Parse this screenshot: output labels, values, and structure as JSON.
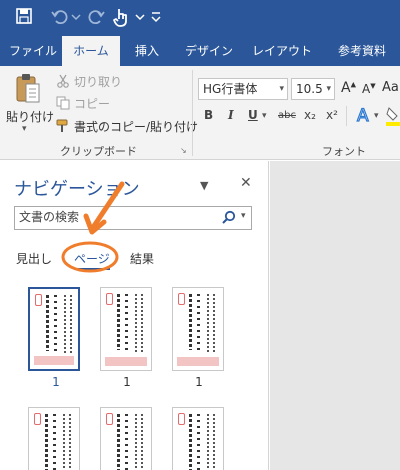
{
  "ribbon_tabs": [
    "ファイル",
    "ホーム",
    "挿入",
    "デザイン",
    "レイアウト",
    "参考資料"
  ],
  "active_tab": "ホーム",
  "clipboard": {
    "paste_label": "貼り付け",
    "cut_label": "切り取り",
    "copy_label": "コピー",
    "format_painter_label": "書式のコピー/貼り付け",
    "group_label": "クリップボード"
  },
  "font": {
    "family": "HG行書体",
    "size": "10.5",
    "grow_label": "A",
    "shrink_label": "A",
    "case_label": "Aa",
    "bold": "B",
    "italic": "I",
    "underline": "U",
    "strikethrough": "abc",
    "subscript": "x₂",
    "superscript": "x²",
    "group_label": "フォント"
  },
  "navigation": {
    "title": "ナビゲーション",
    "search_placeholder": "文書の検索",
    "tabs": [
      "見出し",
      "ページ",
      "結果"
    ],
    "active_tab": "ページ",
    "thumbnails": [
      {
        "page": "1",
        "selected": true
      },
      {
        "page": "1",
        "selected": false
      },
      {
        "page": "1",
        "selected": false
      },
      {
        "page": "",
        "selected": false
      },
      {
        "page": "",
        "selected": false
      },
      {
        "page": "",
        "selected": false
      }
    ]
  },
  "colors": {
    "accent": "#2b579a",
    "annotation": "#f07d2b",
    "ribbon_bg": "#f3f3f3"
  }
}
